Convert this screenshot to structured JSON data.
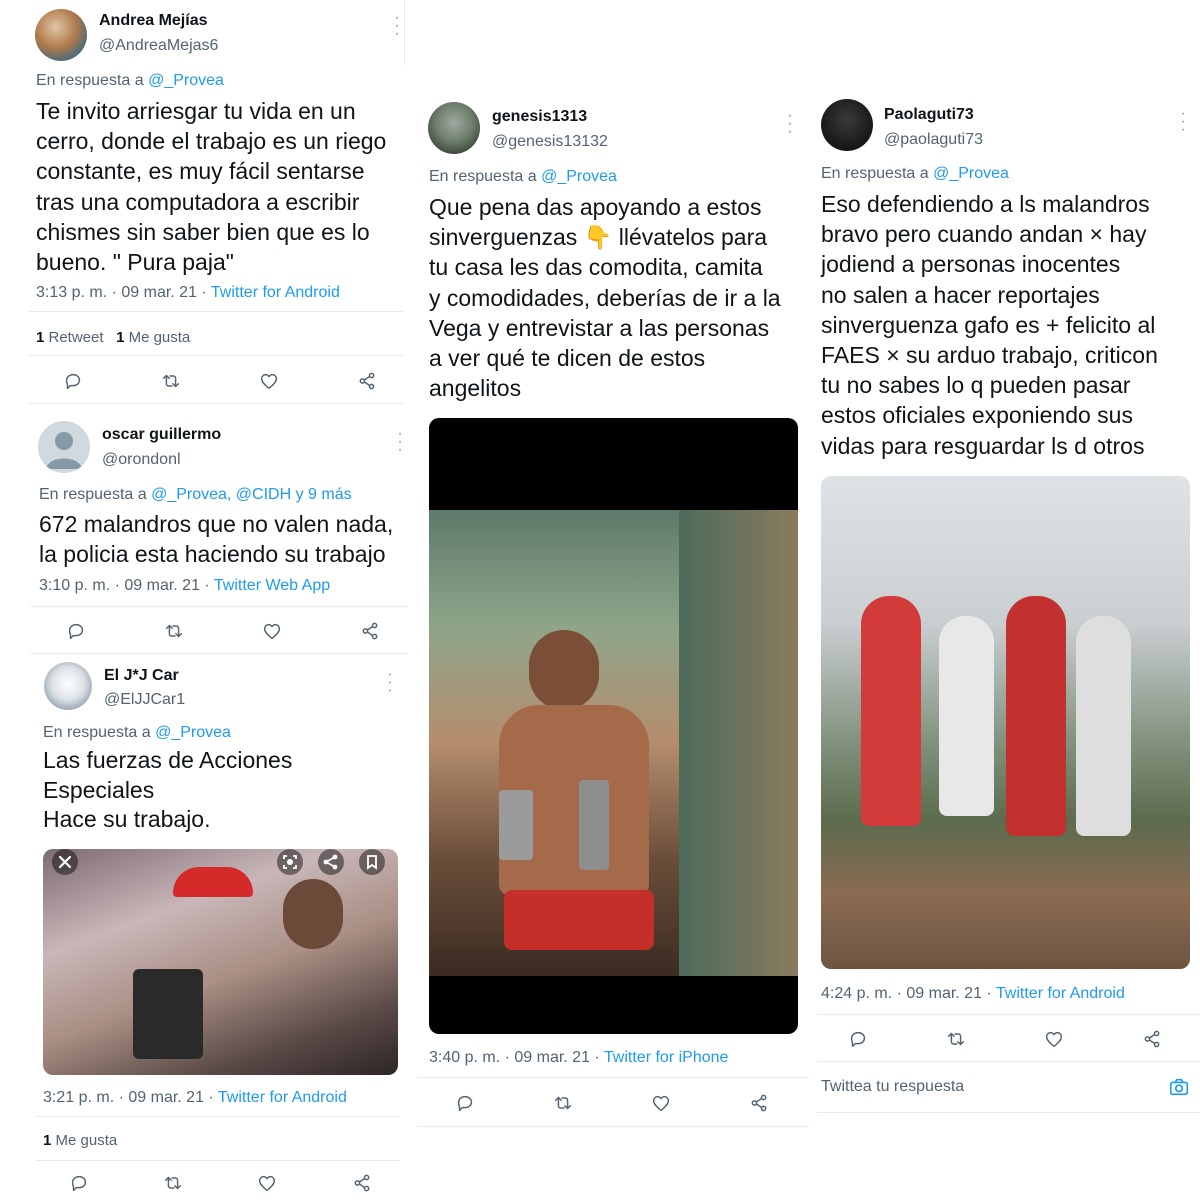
{
  "reply_prefix": "En respuesta a ",
  "tweets": [
    {
      "name": "Andrea Mejías",
      "handle": "@AndreaMejas6",
      "reply_to": "@_Provea",
      "lines": [
        "Te invito arriesgar tu vida en un",
        "cerro, donde el trabajo es un riego",
        "constante, es muy fácil sentarse",
        "tras una computadora a escribir",
        "chismes sin saber bien que es lo",
        "bueno. \" Pura paja\""
      ],
      "time": "3:13 p. m. · 09 mar. 21 · ",
      "source": "Twitter for Android",
      "retweets_count": "1",
      "retweets_label": " Retweet",
      "likes_count": "1",
      "likes_label": " Me gusta"
    },
    {
      "name": "oscar guillermo",
      "handle": "@orondonl",
      "reply_to": "@_Provea, @CIDH y 9 más",
      "lines": [
        "672 malandros que no valen nada,",
        "la policia esta haciendo su trabajo"
      ],
      "time": "3:10 p. m. · 09 mar. 21 · ",
      "source": "Twitter Web App"
    },
    {
      "name": "El J*J Car",
      "handle": "@ElJJCar1",
      "reply_to": "@_Provea",
      "lines": [
        "Las fuerzas de Acciones",
        "Especiales",
        "Hace su trabajo."
      ],
      "time": "3:21 p. m. · 09 mar. 21 · ",
      "source": "Twitter for Android",
      "likes_count": "1",
      "likes_label": " Me gusta"
    },
    {
      "name": "genesis1313",
      "handle": "@genesis13132",
      "reply_to": "@_Provea",
      "lines": [
        "Que pena das apoyando a estos",
        "sinverguenzas 👇 llévatelos para",
        "tu casa les das comodita, camita",
        "y comodidades, deberías de ir a la",
        "Vega y entrevistar a las personas",
        "a ver qué te dicen de estos",
        "angelitos"
      ],
      "time": "3:40 p. m. · 09 mar. 21 · ",
      "source": "Twitter for iPhone"
    },
    {
      "name": "Paolaguti73",
      "handle": "@paolaguti73",
      "reply_to": "@_Provea",
      "lines": [
        "Eso defendiendo a ls malandros",
        "bravo pero cuando andan × hay",
        "jodiend a personas inocentes",
        "no salen a hacer reportajes",
        "sinverguenza gafo es + felicito al",
        "FAES × su arduo trabajo, criticon",
        "tu no sabes lo q pueden pasar",
        "estos oficiales exponiendo sus",
        "vidas para resguardar ls d otros"
      ],
      "time": "4:24 p. m. · 09 mar. 21 · ",
      "source": "Twitter for Android"
    }
  ],
  "compose_placeholder": "Twittea tu respuesta",
  "icons": [
    "reply-icon",
    "retweet-icon",
    "like-icon",
    "share-icon",
    "more-icon",
    "camera-icon",
    "close-icon",
    "lens-icon",
    "bookmark-icon"
  ],
  "colors": {
    "link": "#1d9bf0",
    "secondary": "#536471",
    "text": "#0f1419",
    "divider": "#e6ecf0"
  }
}
